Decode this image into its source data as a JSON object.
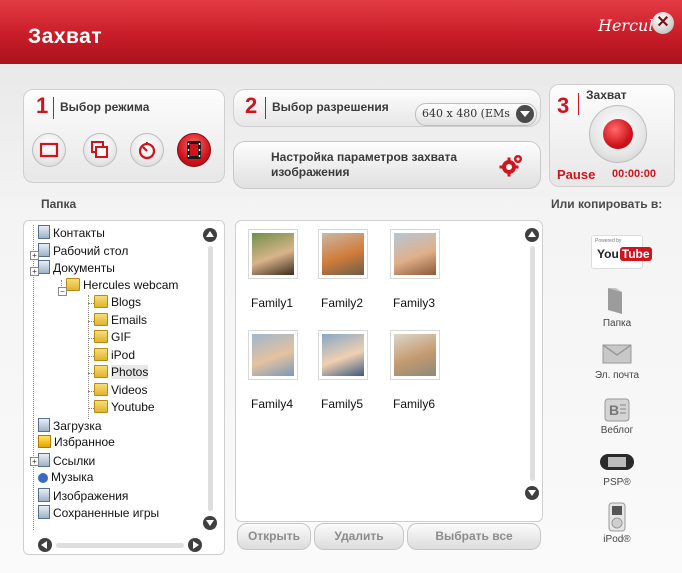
{
  "window": {
    "title": "Захват",
    "brand": "Hercules"
  },
  "step1": {
    "num": "1",
    "label": "Выбор режима"
  },
  "step2": {
    "num": "2",
    "label": "Выбор разрешения",
    "resolution": "640 x 480 (EMs",
    "settings_label": "Настройка параметров захвата изображения"
  },
  "step3": {
    "num": "3",
    "label": "Захват",
    "pause_label": "Pause",
    "timer": "00:00:00"
  },
  "folder_header": "Папка",
  "copy_header": "Или копировать в:",
  "tree": [
    {
      "label": "Контакты",
      "icon": "contacts-icon"
    },
    {
      "label": "Рабочий стол",
      "icon": "desktop-icon"
    },
    {
      "label": "Документы",
      "icon": "documents-icon"
    },
    {
      "label": "Hercules webcam",
      "icon": "folder-icon"
    },
    {
      "label": "Blogs",
      "icon": "folder-icon"
    },
    {
      "label": "Emails",
      "icon": "folder-icon"
    },
    {
      "label": "GIF",
      "icon": "folder-icon"
    },
    {
      "label": "iPod",
      "icon": "folder-icon"
    },
    {
      "label": "Photos",
      "icon": "folder-icon"
    },
    {
      "label": "Videos",
      "icon": "folder-icon"
    },
    {
      "label": "Youtube",
      "icon": "folder-icon"
    },
    {
      "label": "Загрузка",
      "icon": "downloads-icon"
    },
    {
      "label": "Избранное",
      "icon": "favorites-icon"
    },
    {
      "label": "Ссылки",
      "icon": "links-icon"
    },
    {
      "label": "Музыка",
      "icon": "music-icon"
    },
    {
      "label": "Изображения",
      "icon": "pictures-icon"
    },
    {
      "label": "Сохраненные игры",
      "icon": "saved-games-icon"
    }
  ],
  "photos": [
    "Family1",
    "Family2",
    "Family3",
    "Family4",
    "Family5",
    "Family6"
  ],
  "buttons": {
    "open": "Открыть",
    "delete": "Удалить",
    "select_all": "Выбрать все"
  },
  "share": {
    "youtube_small": "Powered by",
    "youtube_you": "You",
    "youtube_tube": "Tube",
    "folder": "Папка",
    "email": "Эл. почта",
    "blog": "Веблог",
    "psp": "PSP®",
    "ipod": "iPod®"
  },
  "colors": {
    "accent": "#d0141d",
    "titlebar": "#c81d28"
  }
}
